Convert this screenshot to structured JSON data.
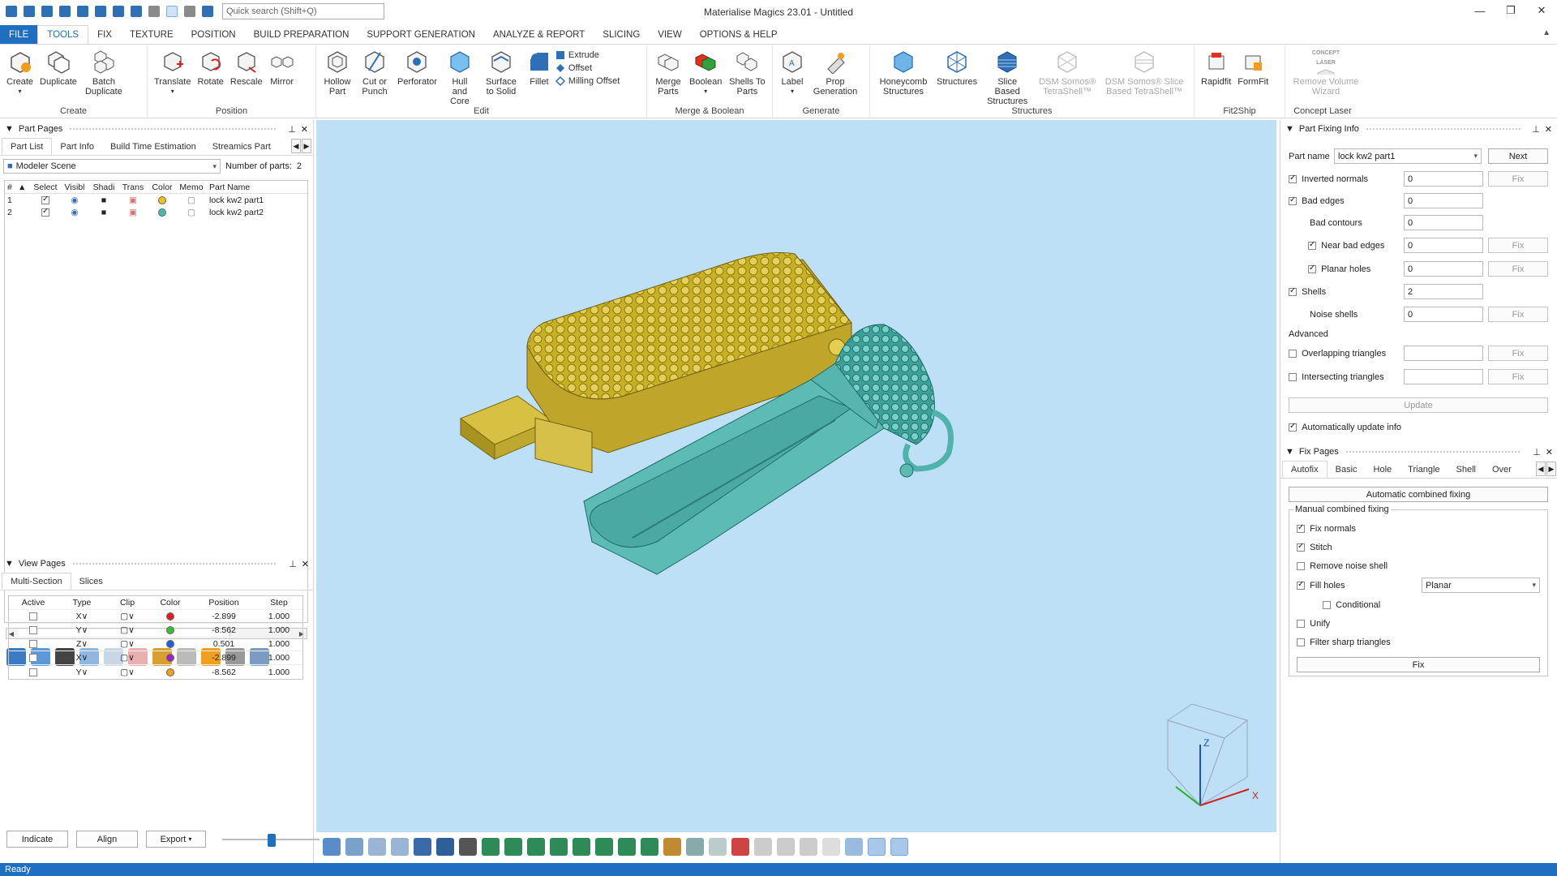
{
  "app": {
    "title": "Materialise Magics 23.01 - Untitled",
    "search_placeholder": "Quick search (Shift+Q)"
  },
  "ribbon_tabs": [
    "FILE",
    "TOOLS",
    "FIX",
    "TEXTURE",
    "POSITION",
    "BUILD PREPARATION",
    "SUPPORT GENERATION",
    "ANALYZE & REPORT",
    "SLICING",
    "VIEW",
    "OPTIONS & HELP"
  ],
  "ribbon": {
    "create": {
      "label": "Create",
      "buttons": [
        "Create",
        "Duplicate",
        "Batch Duplicate"
      ]
    },
    "position": {
      "label": "Position",
      "buttons": [
        "Translate",
        "Rotate",
        "Rescale",
        "Mirror"
      ]
    },
    "edit": {
      "label": "Edit",
      "buttons": [
        "Hollow Part",
        "Cut or Punch",
        "Perforator",
        "Hull and Core",
        "Surface to Solid",
        "Fillet"
      ],
      "small": [
        "Extrude",
        "Offset",
        "Milling Offset"
      ]
    },
    "merge": {
      "label": "Merge & Boolean",
      "buttons": [
        "Merge Parts",
        "Boolean",
        "Shells To Parts"
      ]
    },
    "generate": {
      "label": "Generate",
      "buttons": [
        "Label",
        "Prop Generation"
      ]
    },
    "structures": {
      "label": "Structures",
      "buttons": [
        "Honeycomb Structures",
        "Structures",
        "Slice Based Structures",
        "DSM Somos® TetraShell™",
        "DSM Somos® Slice Based TetraShell™"
      ]
    },
    "fit2ship": {
      "label": "Fit2Ship",
      "buttons": [
        "Rapidfit",
        "FormFit"
      ]
    },
    "concept": {
      "label": "Concept Laser",
      "buttons": [
        "Remove Volume Wizard"
      ],
      "logo_text": "CONCEPT LASER"
    }
  },
  "part_pages": {
    "title": "Part Pages",
    "tabs": [
      "Part List",
      "Part Info",
      "Build Time Estimation",
      "Streamics Part"
    ],
    "scene": "Modeler Scene",
    "parts_count_label": "Number of parts:",
    "parts_count": "2",
    "columns": [
      "#",
      "Select",
      "Visibl",
      "Shadi",
      "Trans",
      "Color",
      "Memo",
      "Part Name"
    ],
    "rows": [
      {
        "num": "1",
        "name": "lock kw2 part1",
        "color": "#e8c41c"
      },
      {
        "num": "2",
        "name": "lock kw2 part2",
        "color": "#45b9b1"
      }
    ]
  },
  "view_pages": {
    "title": "View Pages",
    "tabs": [
      "Multi-Section",
      "Slices"
    ],
    "columns": [
      "Active",
      "Type",
      "Clip",
      "Color",
      "Position",
      "Step"
    ],
    "rows": [
      {
        "type": "X",
        "color": "#e02020",
        "position": "-2.899",
        "step": "1.000"
      },
      {
        "type": "Y",
        "color": "#33c033",
        "position": "-8.562",
        "step": "1.000"
      },
      {
        "type": "Z",
        "color": "#2060e0",
        "position": "0.501",
        "step": "1.000"
      },
      {
        "type": "X",
        "color": "#a020d0",
        "position": "-2.899",
        "step": "1.000"
      },
      {
        "type": "Y",
        "color": "#f0a020",
        "position": "-8.562",
        "step": "1.000"
      }
    ],
    "buttons": [
      "Indicate",
      "Align",
      "Export"
    ]
  },
  "part_fixing": {
    "title": "Part Fixing Info",
    "part_name_label": "Part name",
    "part_name": "lock kw2 part1",
    "next_label": "Next",
    "fix_label": "Fix",
    "items": {
      "inverted_normals": {
        "label": "Inverted normals",
        "value": "0"
      },
      "bad_edges": {
        "label": "Bad edges",
        "value": "0"
      },
      "bad_contours": {
        "label": "Bad contours",
        "value": "0"
      },
      "near_bad_edges": {
        "label": "Near bad edges",
        "value": "0"
      },
      "planar_holes": {
        "label": "Planar holes",
        "value": "0"
      },
      "shells": {
        "label": "Shells",
        "value": "2"
      },
      "noise_shells": {
        "label": "Noise shells",
        "value": "0"
      }
    },
    "advanced_label": "Advanced",
    "overlapping": "Overlapping triangles",
    "intersecting": "Intersecting triangles",
    "update_label": "Update",
    "auto_update": "Automatically update info"
  },
  "fix_pages": {
    "title": "Fix Pages",
    "tabs": [
      "Autofix",
      "Basic",
      "Hole",
      "Triangle",
      "Shell",
      "Over"
    ],
    "auto_combined": "Automatic combined fixing",
    "manual_label": "Manual combined fixing",
    "options": {
      "fix_normals": "Fix normals",
      "stitch": "Stitch",
      "remove_noise": "Remove noise shell",
      "fill_holes": "Fill holes",
      "conditional": "Conditional",
      "unify": "Unify",
      "filter_sharp": "Filter sharp triangles"
    },
    "fill_mode": "Planar",
    "fix_button": "Fix"
  },
  "viewcube": {
    "z": "Z",
    "x": "X"
  },
  "status": "Ready",
  "colors": {
    "accent": "#1e6fc2",
    "viewport": "#bde0f6",
    "part1": "#c9b126",
    "part2": "#4fb3ac"
  }
}
